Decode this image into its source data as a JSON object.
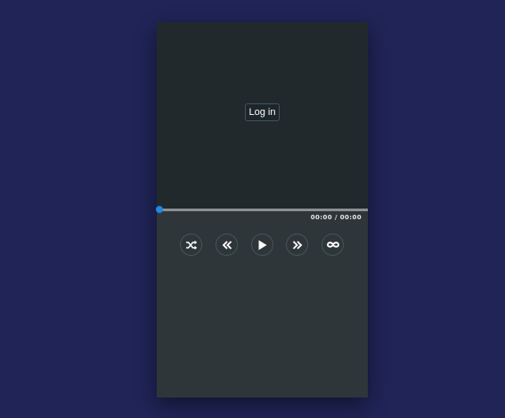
{
  "player": {
    "login_label": "Log in",
    "time_current": "00:00",
    "time_separator": " / ",
    "time_total": "00:00",
    "progress": 0,
    "accent_color": "#1e88e5",
    "background_color": "#202457"
  },
  "controls": [
    {
      "name": "shuffle",
      "icon": "shuffle-icon"
    },
    {
      "name": "previous",
      "icon": "double-chevron-left-icon"
    },
    {
      "name": "play",
      "icon": "play-icon"
    },
    {
      "name": "next",
      "icon": "double-chevron-right-icon"
    },
    {
      "name": "repeat",
      "icon": "infinity-icon"
    }
  ]
}
